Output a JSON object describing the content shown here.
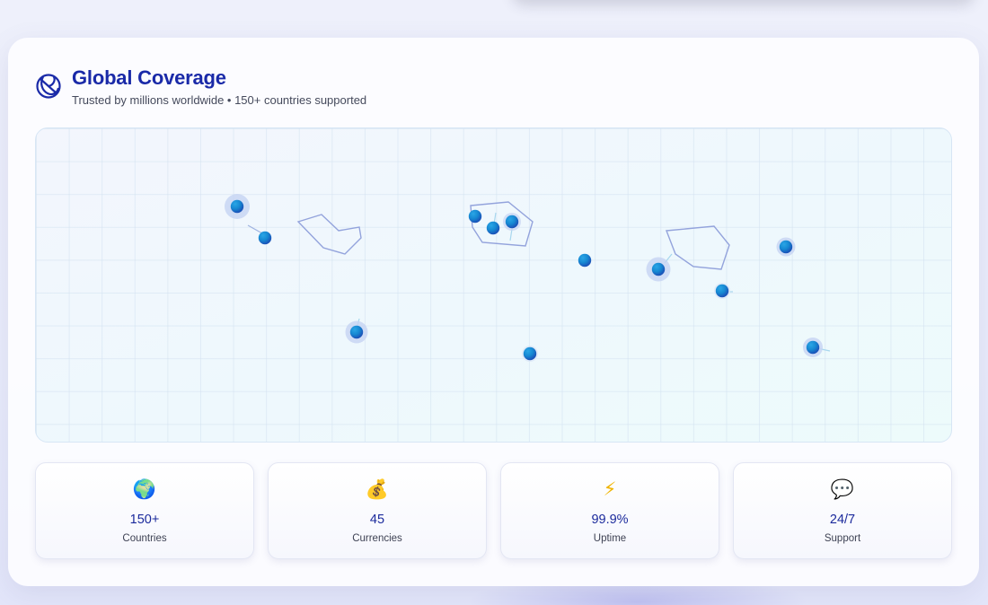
{
  "header": {
    "title": "Global Coverage",
    "subtitle": "Trusted by millions worldwide • 150+ countries supported"
  },
  "stats": [
    {
      "icon": "globe-emoji-icon",
      "emoji": "🌍",
      "value": "150+",
      "label": "Countries"
    },
    {
      "icon": "money-bag-icon",
      "emoji": "💰",
      "value": "45",
      "label": "Currencies"
    },
    {
      "icon": "lightning-icon",
      "emoji": "⚡",
      "value": "99.9%",
      "label": "Uptime"
    },
    {
      "icon": "speech-bubble-icon",
      "emoji": "💬",
      "value": "24/7",
      "label": "Support"
    }
  ],
  "colors": {
    "title": "#1a2aa8",
    "accent_dot": "#1a8fd8",
    "map_outline": "#8f9fd8"
  }
}
